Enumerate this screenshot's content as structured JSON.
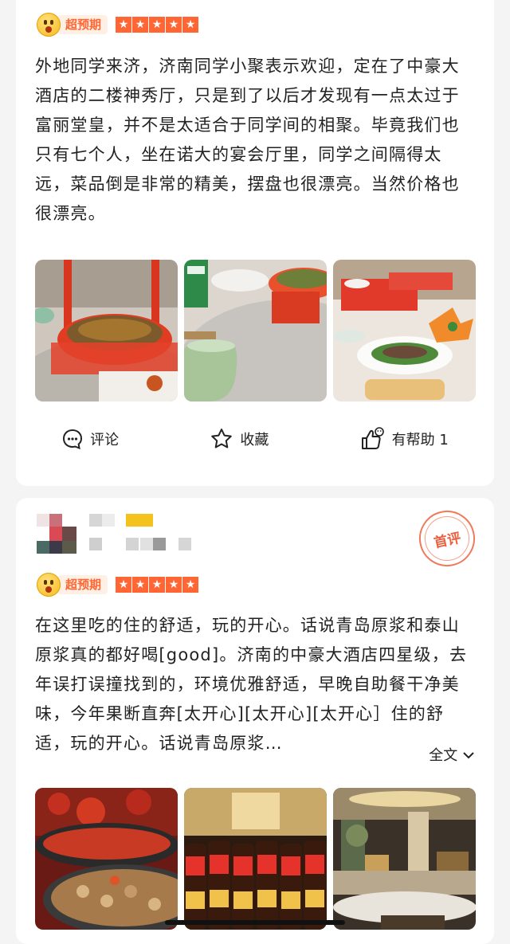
{
  "review1": {
    "badge": "超预期",
    "rating": 5,
    "text": "外地同学来济，济南同学小聚表示欢迎，定在了中豪大酒店的二楼神秀厅，只是到了以后才发现有一点太过于富丽堂皇，并不是太适合于同学间的相聚。毕竟我们也只有七个人，坐在诺大的宴会厅里，同学之间隔得太远，菜品倒是非常的精美，摆盘也很漂亮。当然价格也很漂亮。",
    "photos": [
      "photo-dishes-red-tray",
      "photo-teacup-turntable",
      "photo-banquet-table"
    ],
    "actions": {
      "comment": "评论",
      "favorite": "收藏",
      "helpful": "有帮助 1"
    }
  },
  "review2": {
    "stamp": "首评",
    "badge": "超预期",
    "rating": 5,
    "text": "在这里吃的住的舒适，玩的开心。话说青岛原浆和泰山原浆真的都好喝[good]。济南的中豪大酒店四星级，去年误打误撞找到的，环境优雅舒适，早晚自助餐干净美味，今年果断直奔[太开心][太开心][太开心］住的舒适，玩的开心。话说青岛原浆…",
    "more": "全文",
    "photos": [
      "photo-spicy-crayfish",
      "photo-beer-bottles",
      "photo-buffet-hall"
    ]
  },
  "colors": {
    "accent": "#ff6633",
    "card": "#ffffff",
    "background": "#f4f4f4"
  },
  "icons": [
    "comment-icon",
    "star-outline-icon",
    "thumbs-up-icon",
    "chevron-down-icon"
  ]
}
